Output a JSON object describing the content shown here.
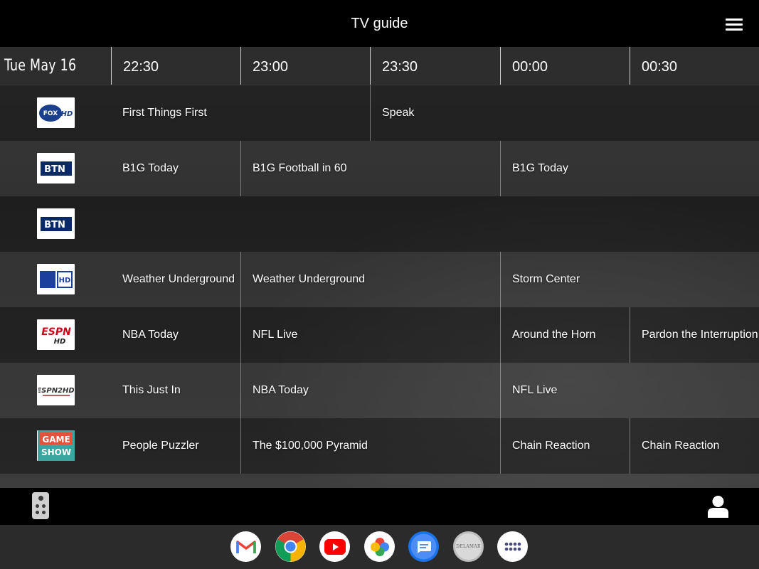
{
  "header": {
    "title": "TV guide",
    "menu_icon": "hamburger-menu-icon"
  },
  "timeline": {
    "date": "Tue May 16",
    "slots": [
      "22:30",
      "23:00",
      "23:30",
      "00:00",
      "00:30"
    ]
  },
  "channels": [
    {
      "logo": "fox-sports-hd-logo",
      "logo_text": "FOX HD",
      "programs": [
        "First Things First",
        "Speak"
      ]
    },
    {
      "logo": "btn-logo",
      "logo_text": "BTN",
      "programs": [
        "B1G Today",
        "B1G Football in 60",
        "B1G Today"
      ]
    },
    {
      "logo": "btn-logo",
      "logo_text": "BTN",
      "programs": []
    },
    {
      "logo": "weather-channel-hd-logo",
      "logo_text": "HD",
      "programs": [
        "Weather Underground",
        "Weather Underground",
        "Storm Center"
      ]
    },
    {
      "logo": "espn-hd-logo",
      "logo_text": "ESPN HD",
      "programs": [
        "NBA Today",
        "NFL Live",
        "Around the Horn",
        "Pardon the Interruption"
      ]
    },
    {
      "logo": "espn2-hd-logo",
      "logo_text": "ESPN2 HD",
      "programs": [
        "This Just In",
        "NBA Today",
        "NFL Live"
      ]
    },
    {
      "logo": "game-show-network-logo",
      "logo_text": "GAME SHOW",
      "programs": [
        "People Puzzler",
        "The $100,000 Pyramid",
        "Chain Reaction",
        "Chain Reaction"
      ]
    }
  ],
  "footer": {
    "remote_icon": "remote-control-icon",
    "profile_icon": "person-icon"
  },
  "dock": {
    "apps": [
      "gmail-icon",
      "chrome-icon",
      "youtube-icon",
      "photos-icon",
      "messages-icon",
      "delamar-icon",
      "app-drawer-icon"
    ],
    "delamar_label": "DELAMAR"
  }
}
